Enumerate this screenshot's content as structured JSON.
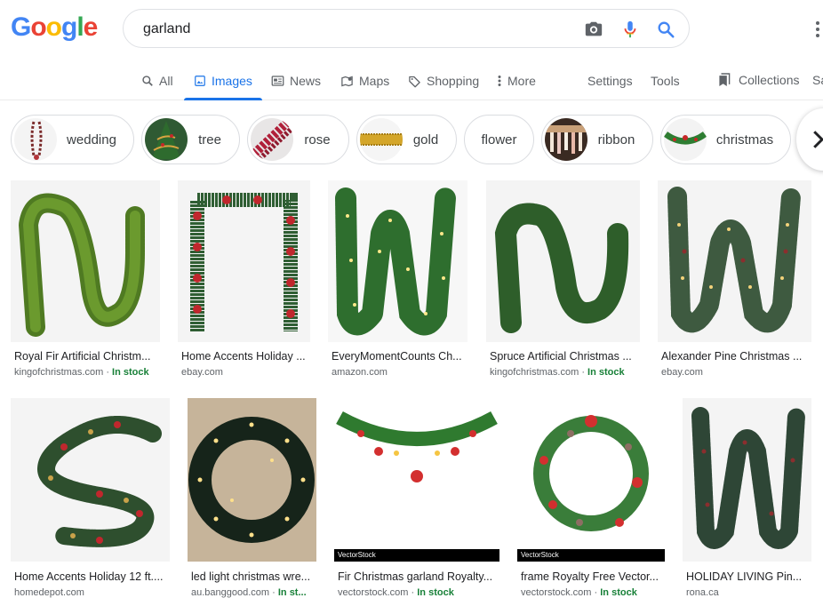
{
  "header": {
    "logo": [
      "G",
      "o",
      "o",
      "g",
      "l",
      "e"
    ],
    "logo_colors": [
      "#4285f4",
      "#ea4335",
      "#fbbc05",
      "#4285f4",
      "#34a853",
      "#ea4335"
    ],
    "query": "garland"
  },
  "tabs": [
    {
      "label": "All",
      "icon": "search-icon"
    },
    {
      "label": "Images",
      "icon": "image-icon"
    },
    {
      "label": "News",
      "icon": "news-icon"
    },
    {
      "label": "Maps",
      "icon": "map-icon"
    },
    {
      "label": "Shopping",
      "icon": "tag-icon"
    },
    {
      "label": "More",
      "icon": "more-vert-icon"
    },
    {
      "label": "Settings"
    },
    {
      "label": "Tools"
    },
    {
      "label": "Collections",
      "icon": "bookmark-icon"
    },
    {
      "label": "Sa"
    }
  ],
  "chips": [
    "wedding",
    "tree",
    "rose",
    "gold",
    "flower",
    "ribbon",
    "christmas"
  ],
  "results": [
    {
      "title": "Royal Fir Artificial Christm...",
      "source": "kingofchristmas.com",
      "stock": "In stock"
    },
    {
      "title": "Home Accents Holiday ...",
      "source": "ebay.com",
      "stock": ""
    },
    {
      "title": "EveryMomentCounts Ch...",
      "source": "amazon.com",
      "stock": ""
    },
    {
      "title": "Spruce Artificial Christmas ...",
      "source": "kingofchristmas.com",
      "stock": "In stock"
    },
    {
      "title": "Alexander Pine Christmas ...",
      "source": "ebay.com",
      "stock": ""
    },
    {
      "title": "Home Accents Holiday 12 ft....",
      "source": "homedepot.com",
      "stock": ""
    },
    {
      "title": "led light christmas wre...",
      "source": "au.banggood.com",
      "stock": "In st..."
    },
    {
      "title": "Fir Christmas garland Royalty...",
      "source": "vectorstock.com",
      "stock": "In stock"
    },
    {
      "title": "frame Royalty Free Vector...",
      "source": "vectorstock.com",
      "stock": "In stock"
    },
    {
      "title": "HOLIDAY LIVING Pin...",
      "source": "rona.ca",
      "stock": ""
    }
  ],
  "watermark": "VectorStock"
}
